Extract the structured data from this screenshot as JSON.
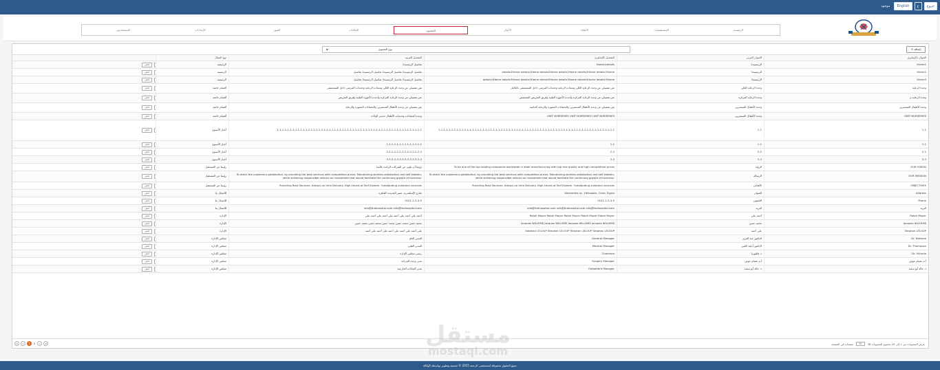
{
  "topbar": {
    "buttons": [
      {
        "label": "خروج"
      },
      {
        "label": "ع"
      },
      {
        "label": "English"
      }
    ],
    "lang_label": "موجود"
  },
  "nav": {
    "items": [
      {
        "label": "الرئيسية",
        "active": false
      },
      {
        "label": "المستشفيات",
        "active": false
      },
      {
        "label": "الأطباء",
        "active": false
      },
      {
        "label": "الأخبار",
        "active": false
      },
      {
        "label": "المحتوى",
        "active": true
      },
      {
        "label": "الإعلانات",
        "active": false
      },
      {
        "label": "الصور",
        "active": false
      },
      {
        "label": "الإعدادات",
        "active": false
      },
      {
        "label": "المستخدمين",
        "active": false
      }
    ]
  },
  "toolbar": {
    "add_label": "+ إضافة",
    "select_value": "نوع المحتوى"
  },
  "table": {
    "headers": [
      "العنوان بالإنجليزي",
      "العنوان العربي",
      "التفصيل بالإنجليزي",
      "التفصيل العربية",
      "نوع المقال",
      ""
    ],
    "edit_label": "تعديل",
    "delete_label": "حذف",
    "rows": [
      {
        "c1": "Home1",
        "c2": "الرئيسية1",
        "c3": "Home1details",
        "c4": "تفاصيل الرئيسية1",
        "c5": "الرئيسية"
      },
      {
        "c1": "Home2",
        "c2": "الرئيسية2",
        "c3": "details2Home details2Home details2Home details2Home details2Home details2Home",
        "c4": "تفاصيل الرئيسية2 تفاصيل الرئيسية2 تفاصيل الرئيسية2 تفاصيل",
        "c5": "الرئيسية"
      },
      {
        "c1": "Home3",
        "c2": "الرئيسية3",
        "c3": "details3Home details3Home details3Home details3Home details3Home details3Home details3Home",
        "c4": "تفاصيل الرئيسية3 تفاصيل الرئيسية3 تفاصيل الرئيسية3 تفاصيل",
        "c5": "الرئيسية"
      },
      {
        "c1": "وحدة الرعاية",
        "c2": "وحدة الرعاية الكلي",
        "c3": "نص تفصيلي عن وحدة الرعاية الكلي ومعدات الرعاية وخدمات المرضى داخل المستشفى بالكامل",
        "c4": "نص تفصيلي عن وحدة الرعاية الكلي ومعدات الرعاية وخدمات المرضى داخل المستشفى",
        "c5": "أقسام خاصة"
      },
      {
        "c1": "وحدة الرعاية م",
        "c2": "وحدة الرعاية المركزة",
        "c3": "نص تفصيلي عن وحدة الرعاية المركزة وأحدث الأجهزة الطبية وفريق التمريض المتخصص",
        "c4": "نص تفصيلي عن وحدة الرعاية المركزة وأحدث الأجهزة الطبية وفريق التمريض",
        "c5": "أقسام خاصة"
      },
      {
        "c1": "وحدة الأطفال المبتسرين",
        "c2": "وحدة الأطفال المبتسرين",
        "c3": "نص تفصيلي عن وحدة الأطفال المبتسرين والحضانات المجهزة والرعاية الخاصة",
        "c4": "نص تفصيلي عن وحدة الأطفال المبتسرين والحضانات المجهزة والرعاية",
        "c5": "أقسام خاصة"
      },
      {
        "c1": "UNIT NURSERIES",
        "c2": "وحدة الأطفال المبتسرين",
        "c3": "UNIT NURSERIES UNIT NURSERIES UNIT NURSERIES",
        "c4": "وحدة الحضانات وخدمات الأطفال حديثي الولادة",
        "c5": "أقسام خاصة"
      },
      {
        "c1": "1-1",
        "c2": "1-1",
        "c3": "1-1-1-1-1-1-1-1-1-1-1-1-1-1-1-1-1-1-1-1-1-1-1-1-1-1-1-1-1-1-1-1-1-1-1-1-1-1-1-1-1-1-1-1-1-1-1-1-1-1-1-1-1-1-1-1-1-1-1-1-1-1-1-1-1-1-1-1",
        "c4": "1-1-1-1-1-1-1-1-1-1-1-1-1-1-1-1-1-1-1-1-1-1-1-1-1-1-1-1-1-1-1-1-1-1-1-1-1-1-1-1-1-1-1-1-1-1-1-1-1-1-1-1-1-1-1-1",
        "c5": "أخبار الأسبوع"
      },
      {
        "c1": "1-1",
        "c2": "1-1",
        "c3": "1-1",
        "c4": "1-1-1-1-1-1-1-1-1-1-1-1-1-1",
        "c5": "أخبار الأسبوع"
      },
      {
        "c1": "2-2",
        "c2": "2-2",
        "c3": "2-2",
        "c4": "2-2-2-2-2-2-2-2-2-2-2-2-2-2",
        "c5": "أخبار الأسبوع"
      },
      {
        "c1": "3-3",
        "c2": "3-3",
        "c3": "3-3",
        "c4": "3-3-3-3-3-3-3-3-3-3-3-3-3-3",
        "c5": "أخبار الأسبوع"
      },
      {
        "c1": "OUR VISION",
        "c2": "الرؤية",
        "c3": "To be one of the top leading companies worldwide in steel manufacturing with top end quality and high competitive prices",
        "c4": "رؤيتنا أن نكون من الشركات الرائدة عالميا",
        "c5": "رؤيتنا عن المستقبل"
      },
      {
        "c1": "OUR MISSION",
        "c2": "الرسالة",
        "c3": "To reach the customers satisfaction, by providing the best services with competitive prices. Maintaining workers satisfaction and self esteem, while achieving responsible returns on investment that would facilitate the continuing growth of business.",
        "c4": "To reach the customers satisfaction, by providing the best services with competitive prices. Maintaining workers satisfaction and self esteem, while achieving responsible returns on investment that would facilitate the continuing growth of business.",
        "c5": "رؤيتنا عن المستقبل"
      },
      {
        "c1": "OBJECTIVES",
        "c2": "الأهداف",
        "c3": "Providing Best Services. Always on time Delivery. High Levels of Self Esteem. Outstanding customer services",
        "c4": "Providing Best Services. Always on time Delivery. High Levels of Self Esteem. Outstanding customer services",
        "c5": "رؤيتنا عن المستقبل"
      },
      {
        "c1": "Address",
        "c2": "العنوان",
        "c3": "Alexandria st., Heliopolis, Cairo, Egypt",
        "c4": "شارع الإسكندرية، مصر الجديدة، القاهرة",
        "c5": "للاتصال بنا"
      },
      {
        "c1": "Phone",
        "c2": "التليفون",
        "c3": "0101-2-3-4-5",
        "c4": "0101-2-3-4-5",
        "c5": "للاتصال بنا"
      },
      {
        "c1": "البريد",
        "c2": "البريد",
        "c3": "info@thehospital.com info@thehospital.com info@thehospital.com",
        "c4": "info@thehospital.com info@thehospital.com",
        "c5": "للاتصال بنا"
      },
      {
        "c1": "Ralph Mayer",
        "c2": "أحمد علي",
        "c3": "Ralph Mayer Ralph Mayer Ralph Mayer Ralph Mayer Ralph Mayer",
        "c4": "أحمد علي أحمد علي أحمد علي أحمد علي أحمد علي",
        "c5": "الإدارة"
      },
      {
        "c1": "Jacques WILLEMS",
        "c2": "محمد حسن",
        "c3": "Jacques WILLEMS Jacques WILLEMS Jacques WILLEMS Jacques WILLEMS",
        "c4": "محمد حسن محمد حسن محمد حسن محمد حسن محمد حسن",
        "c5": "الإدارة"
      },
      {
        "c1": "Stephan LELOUP",
        "c2": "علي أحمد",
        "c3": "Stephan LELOUP Stephan LELOUP Stephan LELOUP Stephan LELOUP",
        "c4": "علي أحمد علي أحمد علي أحمد علي أحمد علي أحمد",
        "c5": "الإدارة"
      },
      {
        "c1": "Dr. Nielsma",
        "c2": "الدكتور عبد العزيز",
        "c3": "General Manager",
        "c4": "المدير العام",
        "c5": "مجلس الإدارة"
      },
      {
        "c1": "Dr. Thompson",
        "c2": "الدكتور أحمد الكبير",
        "c3": "Medical Manager",
        "c4": "المدير الطبي",
        "c5": "مجلس الإدارة"
      },
      {
        "c1": "Dr. Victoria",
        "c2": "د. فكتوريا",
        "c3": "Chairman",
        "c4": "رئيس مجلس الإدارة",
        "c5": "مجلس الإدارة"
      },
      {
        "c1": "أ.م عصام عوض",
        "c2": "أ.م عصام عوض",
        "c3": "Surgery Manager",
        "c4": "مدير وحدة الجراحة",
        "c5": "مجلس الإدارة"
      },
      {
        "c1": "د. خالد أبو سعيد",
        "c2": "د. خالد أبو سعيد",
        "c3": "Outpatient Manager",
        "c4": "مدير العيادات الخارجية",
        "c5": "مجلس الإدارة"
      }
    ]
  },
  "pager": {
    "pages": [
      "1",
      "2"
    ],
    "current_page": "1",
    "page_size": "25",
    "page_size_label": "صفحات في الصفحة",
    "info": "عرض المحتويات من 1 إلى 25 مجموع المحتويات 38"
  },
  "footer": {
    "text": "جميع الحقوق محفوظة لمستشفى الرحمة 2015 © تصميم وتطوير بواسطة الوكالة"
  },
  "watermark": {
    "text": "مستقل",
    "subtext": "mostaql.com"
  },
  "colors": {
    "topbar": "#2e5a8a",
    "active_nav_border": "#c1272d",
    "current_page": "#e8611a"
  }
}
